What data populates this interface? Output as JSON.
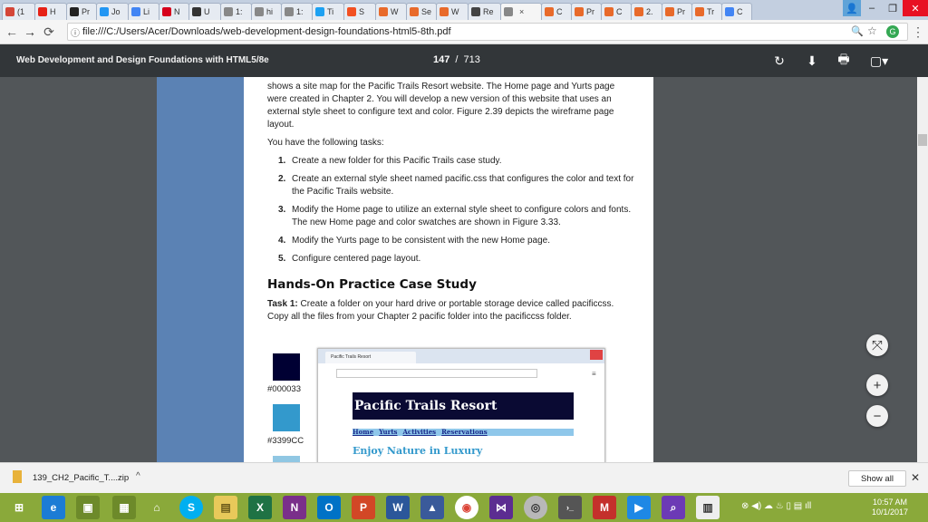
{
  "browser": {
    "tabs": [
      {
        "label": "(1",
        "icon": "gmail-icon",
        "color": "#d44638"
      },
      {
        "label": "H",
        "icon": "youtube-icon",
        "color": "#e62117"
      },
      {
        "label": "Pr",
        "icon": "wikipedia-icon",
        "color": "#222222"
      },
      {
        "label": "Jo",
        "icon": "tumblr-icon",
        "color": "#2196f3"
      },
      {
        "label": "Li",
        "icon": "google-icon",
        "color": "#4285f4"
      },
      {
        "label": "N",
        "icon": "netflix-icon",
        "color": "#d6001c"
      },
      {
        "label": "U",
        "icon": "linkedin-icon",
        "color": "#333333"
      },
      {
        "label": "1:",
        "icon": "page-icon",
        "color": "#888888"
      },
      {
        "label": "hi",
        "icon": "page-icon",
        "color": "#888888"
      },
      {
        "label": "1:",
        "icon": "page-icon",
        "color": "#888888"
      },
      {
        "label": "Ti",
        "icon": "twitter-icon",
        "color": "#1da1f2"
      },
      {
        "label": "S",
        "icon": "microsoft-icon",
        "color": "#f25022"
      },
      {
        "label": "W",
        "icon": "chegg-icon",
        "color": "#e86a2b"
      },
      {
        "label": "Se",
        "icon": "chegg-icon",
        "color": "#e86a2b"
      },
      {
        "label": "W",
        "icon": "chegg-icon",
        "color": "#e86a2b"
      },
      {
        "label": "Re",
        "icon": "bing-icon",
        "color": "#444444"
      },
      {
        "label": "",
        "icon": "page-icon",
        "color": "#888888",
        "active": true
      },
      {
        "label": "C",
        "icon": "chegg-icon",
        "color": "#e86a2b"
      },
      {
        "label": "Pr",
        "icon": "chegg-icon",
        "color": "#e86a2b"
      },
      {
        "label": "C",
        "icon": "chegg-icon",
        "color": "#e86a2b"
      },
      {
        "label": "2.",
        "icon": "chegg-icon",
        "color": "#e86a2b"
      },
      {
        "label": "Pr",
        "icon": "chegg-icon",
        "color": "#e86a2b"
      },
      {
        "label": "Tr",
        "icon": "chegg-icon",
        "color": "#e86a2b"
      },
      {
        "label": "C",
        "icon": "google-icon",
        "color": "#4285f4"
      }
    ],
    "url": "file:///C:/Users/Acer/Downloads/web-development-design-foundations-html5-8th.pdf",
    "window_controls": {
      "minimize": "–",
      "restore": "❐",
      "close": "✕"
    }
  },
  "pdf_toolbar": {
    "title": "Web Development and Design Foundations with HTML5/8e",
    "page_current": "147",
    "page_sep": "/",
    "page_total": "713"
  },
  "document": {
    "intro_lines": [
      "shows a site map for the Pacific Trails Resort website. The Home page and Yurts page",
      "were created in Chapter 2. You will develop a new version of this website that uses an",
      "external style sheet to configure text and color. Figure 2.39 depicts the wireframe page",
      "layout."
    ],
    "tasks_intro": "You have the following tasks:",
    "tasks": [
      {
        "num": "1.",
        "lines": [
          "Create a new folder for this Pacific Trails case study."
        ]
      },
      {
        "num": "2.",
        "lines": [
          "Create an external style sheet named pacific.css that configures the color and text for",
          "the Pacific Trails website."
        ]
      },
      {
        "num": "3.",
        "lines": [
          "Modify the Home page to utilize an external style sheet to configure colors and fonts.",
          "The new Home page and color swatches are shown in Figure 3.33."
        ]
      },
      {
        "num": "4.",
        "lines": [
          "Modify the Yurts page to be consistent with the new Home page."
        ]
      },
      {
        "num": "5.",
        "lines": [
          "Configure centered page layout."
        ]
      }
    ],
    "section_heading": "Hands-On Practice Case Study",
    "task1_label": "Task 1:",
    "task1_text": "Create a folder on your hard drive or portable storage device called pacificcss.",
    "task1_line2": "Copy all the files from your Chapter 2 pacific folder into the pacificcss folder.",
    "swatches": [
      {
        "color": "#000033",
        "label": "#000033"
      },
      {
        "color": "#3399CC",
        "label": "#3399CC"
      },
      {
        "color": "#90C7E3",
        "label": ""
      }
    ],
    "figure": {
      "tab_label": "Pacific Trails Resort",
      "banner": "Pacific Trails Resort",
      "nav": [
        "Home",
        "Yurts",
        "Activities",
        "Reservations"
      ],
      "subheading": "Enjoy Nature in Luxury"
    }
  },
  "downloads": {
    "file": "139_CH2_Pacific_T....zip",
    "show_all": "Show all"
  },
  "taskbar": {
    "time": "10:57 AM",
    "date": "10/1/2017"
  },
  "colors": {
    "pdf_toolbar": "#323639",
    "viewer_bg": "#525659",
    "taskbar": "#8aa93a"
  }
}
